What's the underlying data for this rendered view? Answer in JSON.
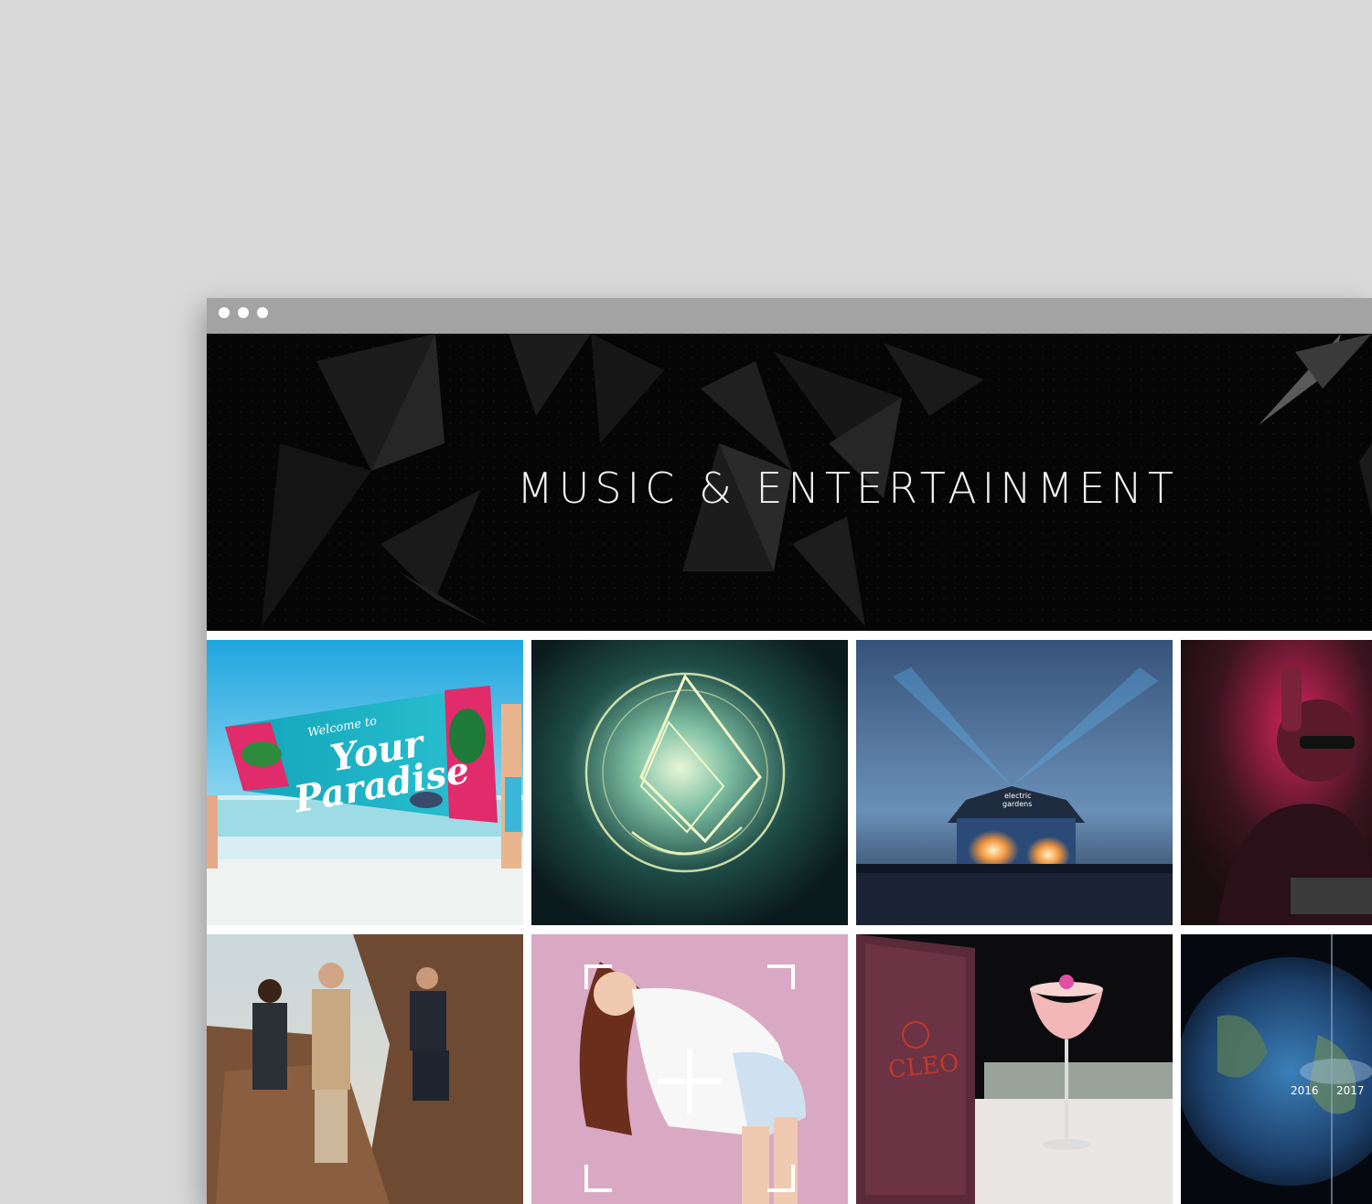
{
  "browser": {
    "window_controls": [
      "dot",
      "dot",
      "dot"
    ]
  },
  "hero": {
    "title": "MUSIC & ENTERTAINMENT"
  },
  "gallery": {
    "tiles": [
      {
        "name": "paradise-towel-banner",
        "texts": {
          "line1": "Welcome to",
          "line2": "Your",
          "line3": "Paradise"
        }
      },
      {
        "name": "glowing-emblem-clouds"
      },
      {
        "name": "electric-gardens-stage",
        "texts": {
          "sign1": "electric",
          "sign2": "gardens"
        }
      },
      {
        "name": "dj-red-light"
      },
      {
        "name": "three-men-on-rocks"
      },
      {
        "name": "model-pink-background"
      },
      {
        "name": "cleo-cocktail",
        "texts": {
          "brand": "CLEO"
        }
      },
      {
        "name": "earth-timeline",
        "texts": {
          "year1": "2016",
          "year2": "2017"
        }
      }
    ]
  },
  "colors": {
    "page_bg": "#d9d9d9",
    "chrome_bar": "#a3a3a3",
    "hero_bg": "#050505",
    "hero_text": "#f2f2f2"
  }
}
